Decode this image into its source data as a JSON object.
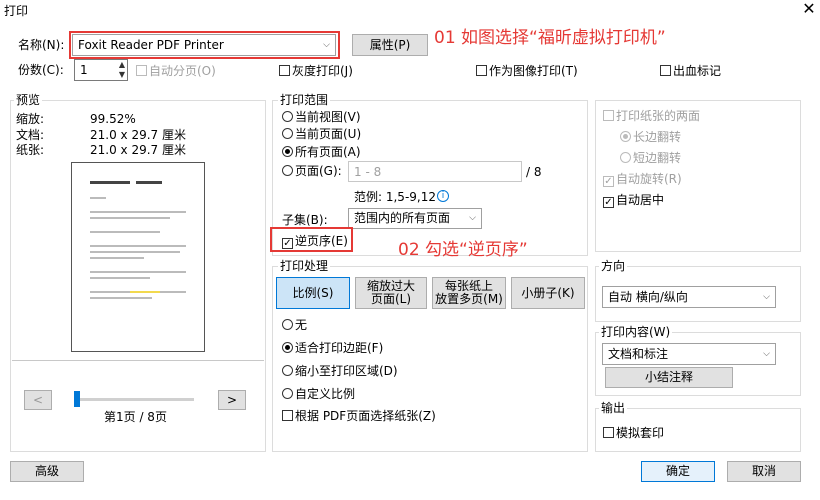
{
  "window": {
    "title": "打印",
    "close_icon": "close-icon"
  },
  "printer": {
    "name_label": "名称(N):",
    "value": "Foxit Reader PDF Printer",
    "properties_button": "属性(P)"
  },
  "copies": {
    "label": "份数(C):",
    "value": "1",
    "collate_label": "自动分页(O)"
  },
  "options": {
    "grayscale": "灰度打印(J)",
    "print_as_image": "作为图像打印(T)",
    "bleed_marks": "出血标记"
  },
  "preview": {
    "group_title": "预览",
    "zoom_label": "缩放:",
    "zoom_value": "99.52%",
    "document_label": "文档:",
    "document_value": "21.0 x 29.7 厘米",
    "paper_label": "纸张:",
    "paper_value": "21.0 x 29.7 厘米",
    "prev_button": "<",
    "next_button": ">",
    "page_indicator": "第1页 / 8页"
  },
  "print_range": {
    "group_title": "打印范围",
    "current_view": "当前视图(V)",
    "current_page": "当前页面(U)",
    "all_pages": "所有页面(A)",
    "pages_label": "页面(G):",
    "pages_placeholder": "1 - 8",
    "pages_total": "/ 8",
    "example": "范例: 1,5-9,12",
    "subset_label": "子集(B):",
    "subset_value": "范围内的所有页面",
    "reverse_label": "逆页序(E)"
  },
  "handling": {
    "group_title": "打印处理",
    "tabs": [
      "比例(S)",
      "缩放过大\n页面(L)",
      "每张纸上\n放置多页(M)",
      "小册子(K)"
    ],
    "none": "无",
    "fit_margins": "适合打印边距(F)",
    "shrink": "缩小至打印区域(D)",
    "custom": "自定义比例",
    "choose_paper": "根据 PDF页面选择纸张(Z)"
  },
  "duplex": {
    "both_sides": "打印纸张的两面",
    "long_edge": "长边翻转",
    "short_edge": "短边翻转",
    "auto_rotate": "自动旋转(R)",
    "auto_center": "自动居中"
  },
  "orientation": {
    "group_title": "方向",
    "value": "自动 横向/纵向"
  },
  "content": {
    "group_title": "打印内容(W)",
    "value": "文档和标注",
    "summarize_button": "小结注释"
  },
  "output": {
    "group_title": "输出",
    "simulate_overprint": "模拟套印"
  },
  "footer": {
    "advanced": "高级",
    "ok": "确定",
    "cancel": "取消"
  },
  "annotations": {
    "step1": "01 如图选择“福昕虚拟打印机”",
    "step2": "02 勾选“逆页序”"
  },
  "colors": {
    "annotation": "#e53935",
    "accent": "#0078d7"
  }
}
